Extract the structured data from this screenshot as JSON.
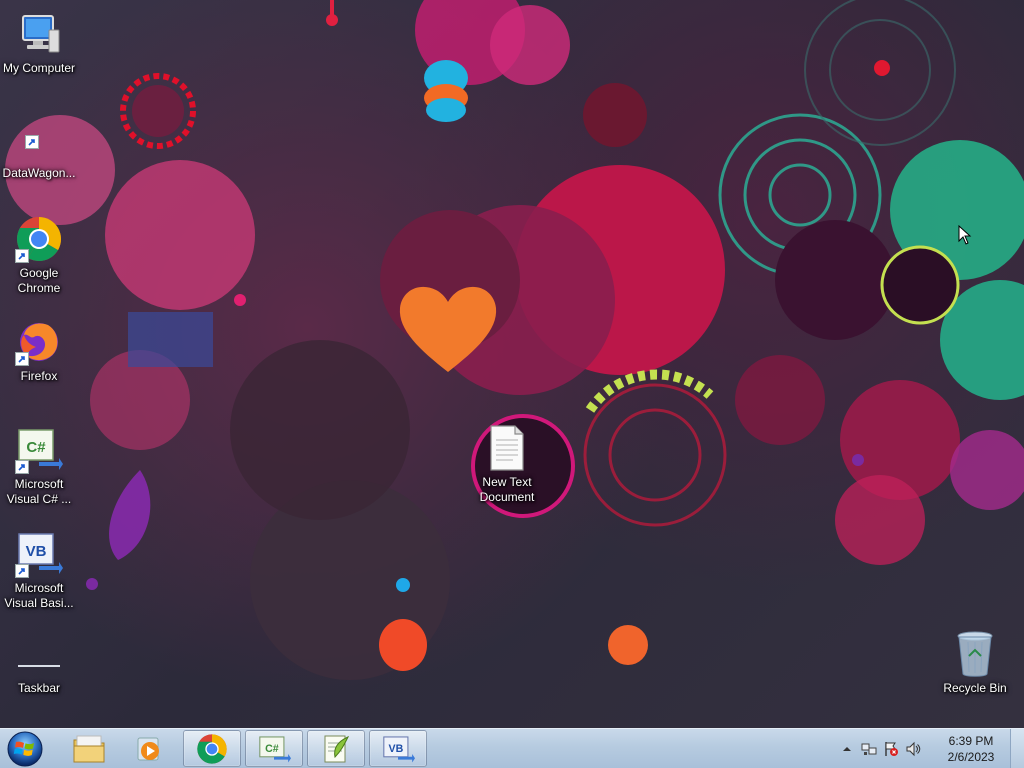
{
  "desktop": {
    "icons": [
      {
        "label": "My Computer",
        "icon": "computer-icon"
      },
      {
        "label": "DataWagon...",
        "icon": "shortcut-icon"
      },
      {
        "label": "Google Chrome",
        "icon": "chrome-icon"
      },
      {
        "label": "Firefox",
        "icon": "firefox-icon"
      },
      {
        "label": "Microsoft Visual C# ...",
        "icon": "csharp-icon"
      },
      {
        "label": "Microsoft Visual Basi...",
        "icon": "vb-icon"
      },
      {
        "label": "Taskbar",
        "icon": "taskbar-icon"
      },
      {
        "label": "New Text Document",
        "icon": "text-document-icon"
      },
      {
        "label": "Recycle Bin",
        "icon": "recycle-bin-icon"
      }
    ]
  },
  "taskbar": {
    "buttons": [
      {
        "icon": "windows-start-icon"
      },
      {
        "icon": "file-explorer-icon"
      },
      {
        "icon": "media-player-icon"
      },
      {
        "icon": "chrome-icon"
      },
      {
        "icon": "csharp-icon"
      },
      {
        "icon": "notepad-plus-icon"
      },
      {
        "icon": "vb-icon"
      }
    ],
    "tray": {
      "clock_time": "6:39 PM",
      "clock_date": "2/6/2023"
    }
  },
  "colors": {
    "taskbar": "#b6cbe0",
    "chrome_red": "#db4437",
    "chrome_green": "#0f9d58",
    "chrome_yellow": "#f4b400",
    "chrome_blue": "#4285f4",
    "csharp_green": "#3a8a3a",
    "vb_blue": "#1f4fa8"
  }
}
